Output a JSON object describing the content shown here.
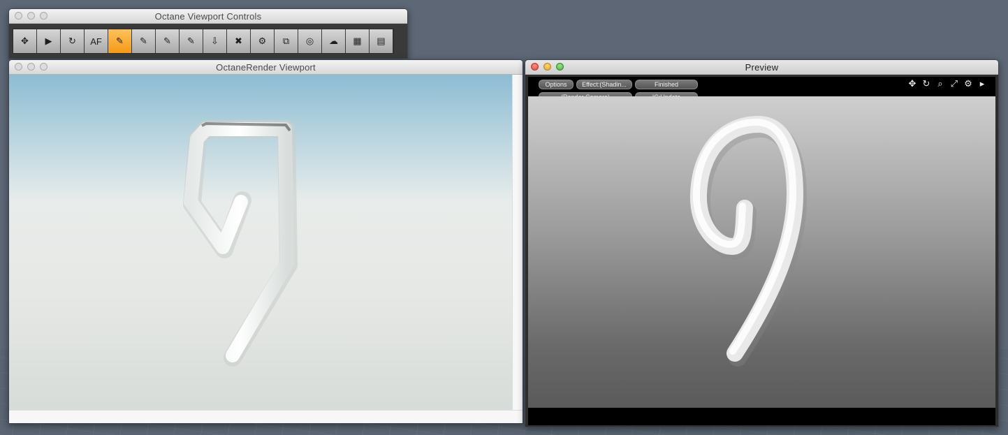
{
  "controls_window": {
    "title": "Octane Viewport Controls",
    "buttons": [
      {
        "name": "fit-view",
        "glyph": "✥",
        "active": false
      },
      {
        "name": "play",
        "glyph": "▶",
        "active": false
      },
      {
        "name": "reset",
        "glyph": "↻",
        "active": false
      },
      {
        "name": "auto-focus",
        "glyph": "AF",
        "active": false
      },
      {
        "name": "focus-picker",
        "glyph": "✎",
        "active": true
      },
      {
        "name": "material-picker",
        "glyph": "✎",
        "active": false
      },
      {
        "name": "region-picker",
        "glyph": "✎",
        "active": false
      },
      {
        "name": "object-picker",
        "glyph": "✎",
        "active": false
      },
      {
        "name": "import",
        "glyph": "⇩",
        "active": false
      },
      {
        "name": "clear",
        "glyph": "✖",
        "active": false
      },
      {
        "name": "settings",
        "glyph": "⚙",
        "active": false
      },
      {
        "name": "export",
        "glyph": "⧉",
        "active": false
      },
      {
        "name": "camera",
        "glyph": "◎",
        "active": false
      },
      {
        "name": "cloud",
        "glyph": "☁",
        "active": false
      },
      {
        "name": "texture",
        "glyph": "▦",
        "active": false
      },
      {
        "name": "info",
        "glyph": "▤",
        "active": false
      }
    ]
  },
  "viewport_window": {
    "title": "OctaneRender Viewport"
  },
  "preview_window": {
    "title": "Preview",
    "options_label": "Options",
    "effect_label": "Effect:(Shadin...",
    "status_label": "Finished",
    "camera_label": "(Render Camera)",
    "update_label": "IC:Update",
    "icons": [
      "move-icon",
      "rotate-icon",
      "zoom-icon",
      "expand-icon",
      "gear-icon",
      "play-arrow-icon"
    ]
  },
  "colors": {
    "active_button": "#f5a623",
    "sky": "#8dbcd3",
    "preview_bg": "#9a9a9a"
  }
}
